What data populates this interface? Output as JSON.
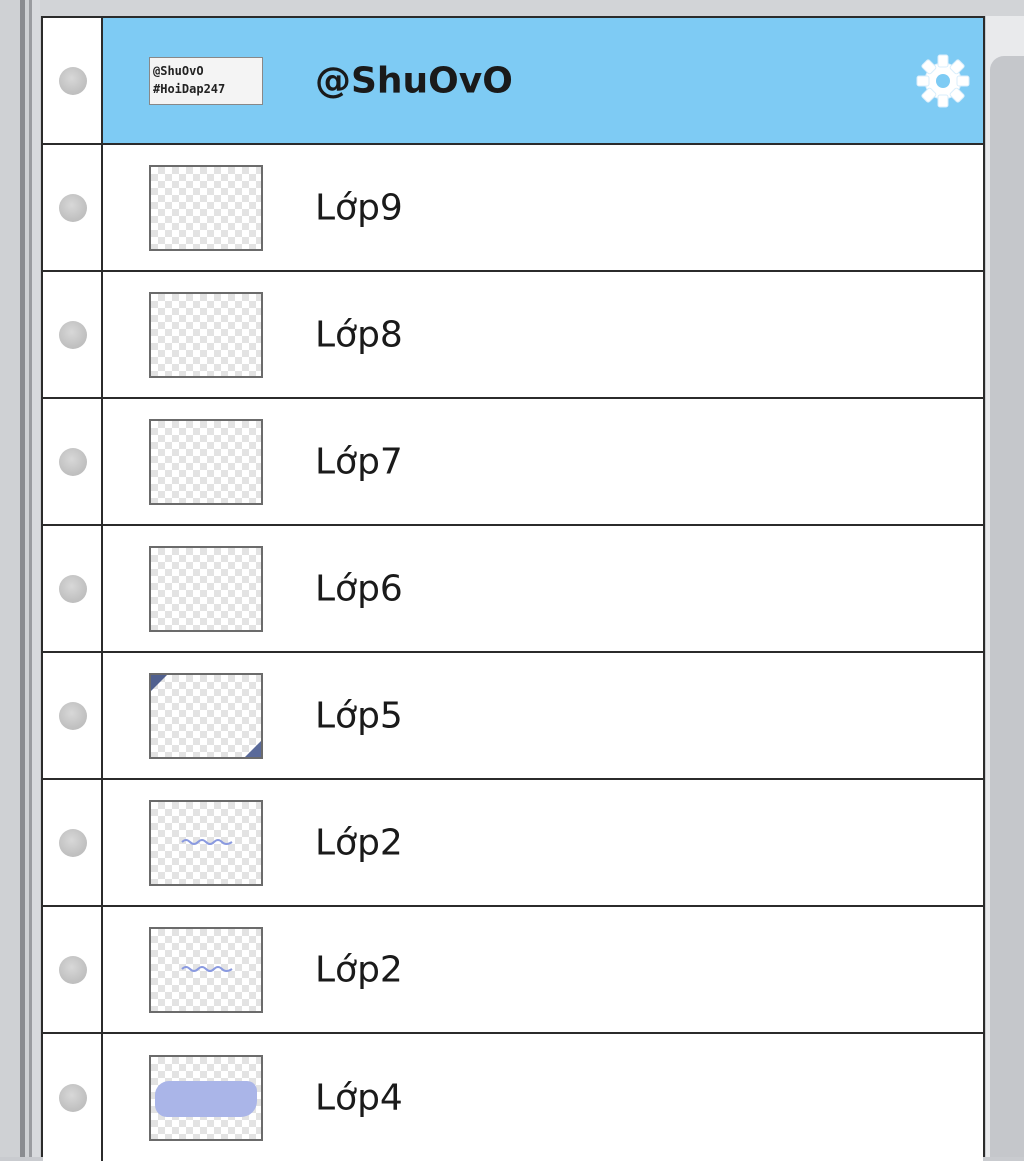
{
  "panel": {
    "layers": [
      {
        "name": "@ShuOvO",
        "thumb_text_line1": "@ShuOvO",
        "thumb_text_line2": "#HoiDap247",
        "selected": true,
        "thumb": "text"
      },
      {
        "name": "Lớp9",
        "thumb": "empty"
      },
      {
        "name": "Lớp8",
        "thumb": "empty"
      },
      {
        "name": "Lớp7",
        "thumb": "empty"
      },
      {
        "name": "Lớp6",
        "thumb": "empty"
      },
      {
        "name": "Lớp5",
        "thumb": "corners"
      },
      {
        "name": "Lớp2",
        "thumb": "squiggle"
      },
      {
        "name": "Lớp2",
        "thumb": "squiggle"
      },
      {
        "name": "Lớp4",
        "thumb": "blob"
      }
    ],
    "icons": {
      "visibility": "visibility-dot-icon",
      "settings": "gear-icon"
    },
    "colors": {
      "selected_row": "#7ecbf4",
      "border": "#2b2b2b",
      "gear": "#ffffff"
    }
  }
}
